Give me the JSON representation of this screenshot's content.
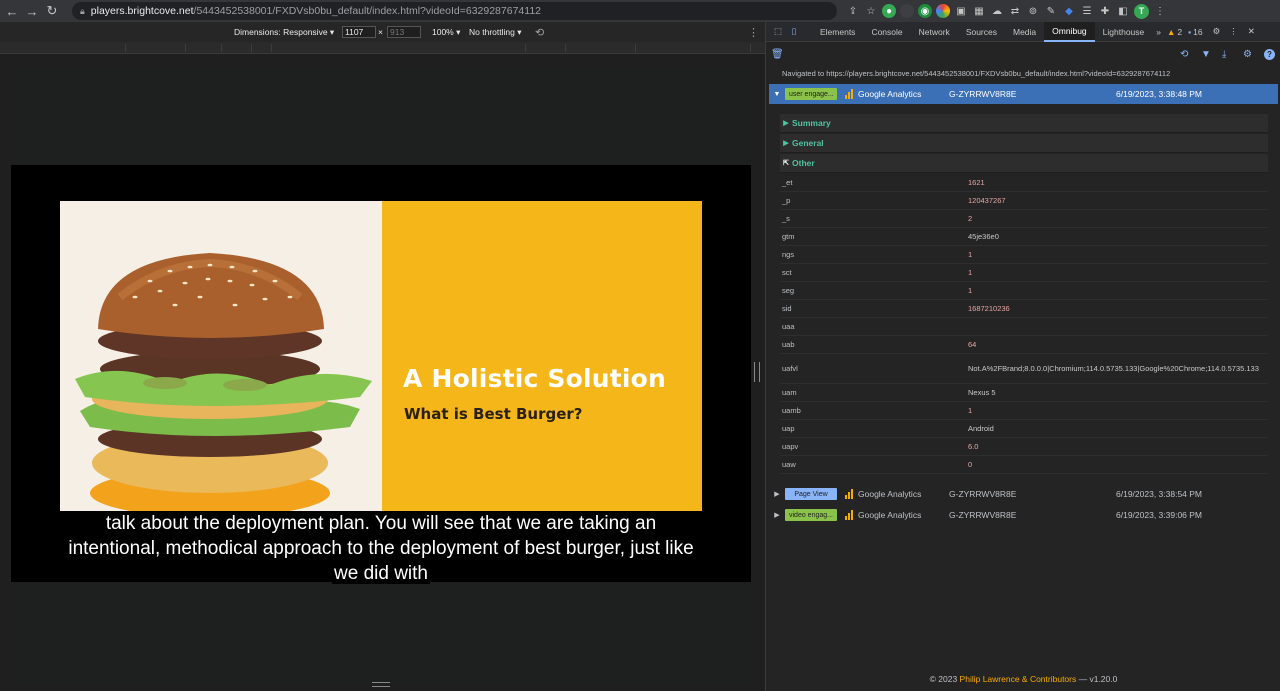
{
  "browser": {
    "url_host": "players.brightcove.net",
    "url_path": "/5443452538001/FXDVsb0bu_default/index.html?videoId=6329287674112",
    "profile_initial": "T"
  },
  "device_toolbar": {
    "dimensions_label": "Dimensions: Responsive ▾",
    "width": "1107",
    "times": "×",
    "height": "913",
    "zoom": "100% ▾",
    "throttling": "No throttling ▾"
  },
  "video": {
    "slide_title": "A Holistic Solution",
    "slide_subtitle": "What is Best Burger?",
    "caption_lines": [
      "talk about the deployment plan. You will see that we are taking an",
      "intentional, methodical approach to the deployment of best burger, just like",
      "we did with"
    ]
  },
  "devtools": {
    "tabs": [
      "Elements",
      "Console",
      "Network",
      "Sources",
      "Media",
      "Omnibug",
      "Lighthouse",
      "»"
    ],
    "active_tab": "Omnibug",
    "warnings": "2",
    "messages": "16",
    "nav_message": "Navigated to https://players.brightcove.net/5443452538001/FXDVsb0bu_default/index.html?videoId=6329287674112",
    "requests": [
      {
        "badge": "user engage...",
        "badge_color": "#8bc34a",
        "provider": "Google Analytics",
        "account": "G-ZYRRWV8R8E",
        "time": "6/19/2023, 3:38:48 PM"
      },
      {
        "badge": "Page View",
        "badge_color": "#8ab4f8",
        "provider": "Google Analytics",
        "account": "G-ZYRRWV8R8E",
        "time": "6/19/2023, 3:38:54 PM"
      },
      {
        "badge": "video engag...",
        "badge_color": "#8bc34a",
        "provider": "Google Analytics",
        "account": "G-ZYRRWV8R8E",
        "time": "6/19/2023, 3:39:06 PM"
      }
    ],
    "sections": [
      "Summary",
      "General",
      "Other"
    ],
    "params": [
      {
        "key": "_et",
        "value": "1621"
      },
      {
        "key": "_p",
        "value": "120437267"
      },
      {
        "key": "_s",
        "value": "2"
      },
      {
        "key": "gtm",
        "value": "45je36e0"
      },
      {
        "key": "ngs",
        "value": "1"
      },
      {
        "key": "sct",
        "value": "1"
      },
      {
        "key": "seg",
        "value": "1"
      },
      {
        "key": "sid",
        "value": "1687210236"
      },
      {
        "key": "uaa",
        "value": ""
      },
      {
        "key": "uab",
        "value": "64"
      },
      {
        "key": "uafvl",
        "value": "Not.A%2FBrand;8.0.0.0|Chromium;114.0.5735.133|Google%20Chrome;114.0.5735.133"
      },
      {
        "key": "uam",
        "value": "Nexus 5"
      },
      {
        "key": "uamb",
        "value": "1"
      },
      {
        "key": "uap",
        "value": "Android"
      },
      {
        "key": "uapv",
        "value": "6.0"
      },
      {
        "key": "uaw",
        "value": "0"
      }
    ],
    "footer_prefix": "© 2023 ",
    "footer_link": "Philip Lawrence & Contributors",
    "footer_suffix": " — v1.20.0"
  }
}
